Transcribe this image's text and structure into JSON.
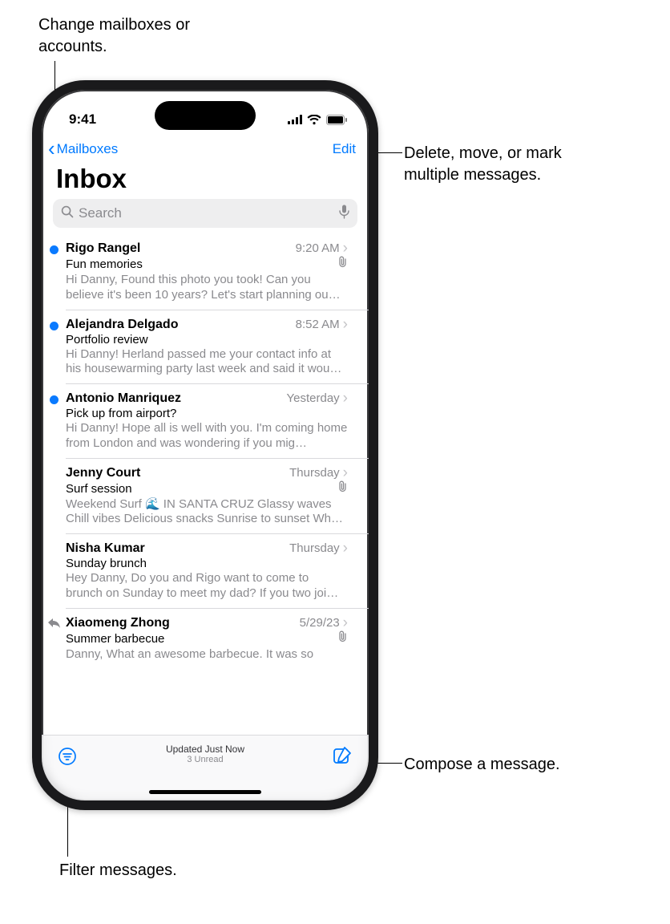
{
  "status": {
    "time": "9:41"
  },
  "nav": {
    "back_label": "Mailboxes",
    "edit_label": "Edit"
  },
  "title": "Inbox",
  "search": {
    "placeholder": "Search"
  },
  "messages": [
    {
      "sender": "Rigo Rangel",
      "time": "9:20 AM",
      "subject": "Fun memories",
      "preview": "Hi Danny, Found this photo you took! Can you believe it's been 10 years? Let's start planning ou…",
      "unread": true,
      "attachment": true,
      "replied": false
    },
    {
      "sender": "Alejandra Delgado",
      "time": "8:52 AM",
      "subject": "Portfolio review",
      "preview": "Hi Danny! Herland passed me your contact info at his housewarming party last week and said it wou…",
      "unread": true,
      "attachment": false,
      "replied": false
    },
    {
      "sender": "Antonio Manriquez",
      "time": "Yesterday",
      "subject": "Pick up from airport?",
      "preview": "Hi Danny! Hope all is well with you. I'm coming home from London and was wondering if you mig…",
      "unread": true,
      "attachment": false,
      "replied": false
    },
    {
      "sender": "Jenny Court",
      "time": "Thursday",
      "subject": "Surf session",
      "preview": "Weekend Surf 🌊 IN SANTA CRUZ Glassy waves Chill vibes Delicious snacks Sunrise to sunset Wh…",
      "unread": false,
      "attachment": true,
      "replied": false
    },
    {
      "sender": "Nisha Kumar",
      "time": "Thursday",
      "subject": "Sunday brunch",
      "preview": "Hey Danny, Do you and Rigo want to come to brunch on Sunday to meet my dad? If you two joi…",
      "unread": false,
      "attachment": false,
      "replied": false
    },
    {
      "sender": "Xiaomeng Zhong",
      "time": "5/29/23",
      "subject": "Summer barbecue",
      "preview": "Danny, What an awesome barbecue. It was so",
      "unread": false,
      "attachment": true,
      "replied": true
    }
  ],
  "toolbar": {
    "updated": "Updated Just Now",
    "unread": "3 Unread"
  },
  "callouts": {
    "mailboxes": "Change mailboxes or accounts.",
    "edit": "Delete, move, or mark multiple messages.",
    "compose": "Compose a message.",
    "filter": "Filter messages."
  }
}
